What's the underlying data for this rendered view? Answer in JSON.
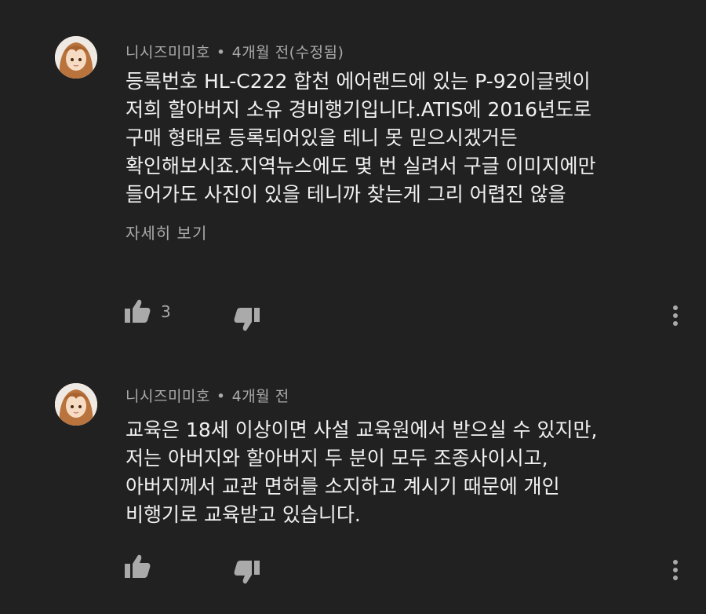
{
  "comments": [
    {
      "author": "니시즈미미호",
      "separator": "•",
      "time": "4개월 전(수정됨)",
      "lines": [
        "등록번호 HL-C222 합천 에어랜드에 있는 P-92이글렛이",
        "저희 할아버지 소유 경비행기입니다.ATIS에 2016년도로",
        "구매 형태로 등록되어있을 테니 못 믿으시겠거든",
        "확인해보시죠.지역뉴스에도 몇 번 실려서 구글 이미지에만",
        "들어가도 사진이 있을 테니까 찾는게 그리 어렵진 않을"
      ],
      "read_more": "자세히 보기",
      "likes": "3"
    },
    {
      "author": "니시즈미미호",
      "separator": "•",
      "time": "4개월 전",
      "lines": [
        "교육은 18세 이상이면 사설 교육원에서 받으실 수 있지만,",
        "저는 아버지와 할아버지 두 분이 모두 조종사이시고,",
        "아버지께서 교관 면허를 소지하고 계시기 때문에 개인",
        "비행기로 교육받고 있습니다."
      ],
      "likes": ""
    }
  ],
  "icons": {
    "like": "thumbs-up-icon",
    "dislike": "thumbs-down-icon",
    "more": "more-vert-icon"
  },
  "colors": {
    "background": "#212121",
    "text_primary": "#f1f1f1",
    "text_secondary": "#aaaaaa"
  }
}
